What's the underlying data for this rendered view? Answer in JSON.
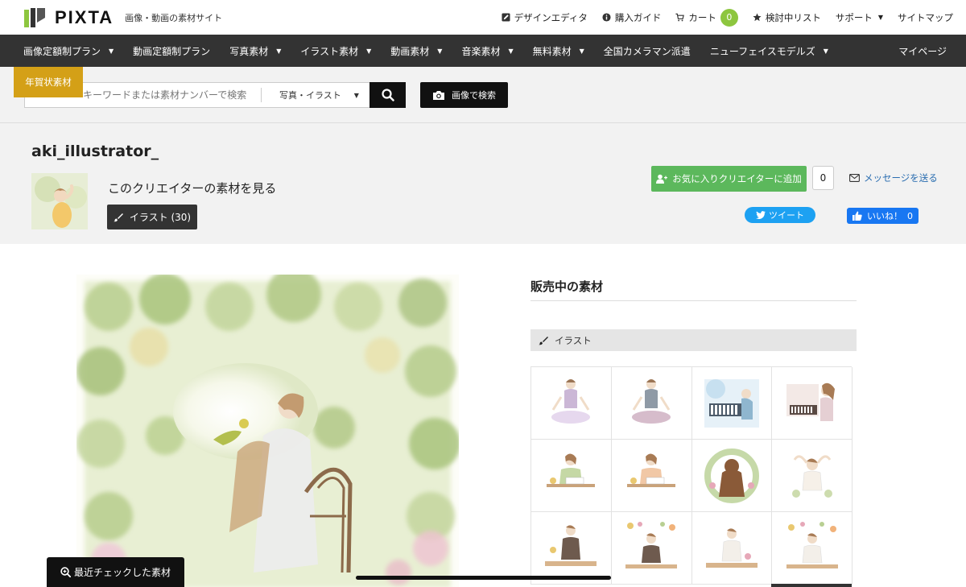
{
  "header": {
    "logo_text": "PIXTA",
    "tagline": "画像・動画の素材サイト",
    "links": [
      {
        "label": "デザインエディタ",
        "icon": "edit-icon"
      },
      {
        "label": "購入ガイド",
        "icon": "info-icon"
      },
      {
        "label": "カート",
        "icon": "cart-icon",
        "badge": "0"
      },
      {
        "label": "検討中リスト",
        "icon": "star-icon"
      },
      {
        "label": "サポート",
        "caret": true
      },
      {
        "label": "サイトマップ"
      }
    ]
  },
  "nav": {
    "items": [
      "画像定額制プラン",
      "動画定額制プラン",
      "写真素材",
      "イラスト素材",
      "動画素材",
      "音楽素材",
      "無料素材",
      "全国カメラマン派遣",
      "ニューフェイスモデルズ"
    ],
    "mypage": "マイページ"
  },
  "search": {
    "nenga_label": "年賀状素材",
    "placeholder": "キーワードまたは素材ナンバーで検索",
    "category": "写真・イラスト",
    "image_search_label": "画像で検索"
  },
  "creator": {
    "name": "aki_illustrator_",
    "see_works": "このクリエイターの素材を見る",
    "illust_count_label": "イラスト (30)",
    "fav_button": "お気に入りクリエイターに追加",
    "fav_count": "0",
    "message_link": "メッセージを送る",
    "tweet_label": "ツイート",
    "like_label": "いいね！",
    "like_count": "0"
  },
  "main": {
    "section_title": "販売中の素材",
    "category_label": "イラスト",
    "thumbnails": [
      {
        "name": "thumb-yoga-woman-1"
      },
      {
        "name": "thumb-yoga-woman-2"
      },
      {
        "name": "thumb-piano-blue"
      },
      {
        "name": "thumb-piano-woman"
      },
      {
        "name": "thumb-desk-woman-1"
      },
      {
        "name": "thumb-desk-woman-2"
      },
      {
        "name": "thumb-flower-wreath"
      },
      {
        "name": "thumb-stretch-woman"
      },
      {
        "name": "thumb-cooking-1"
      },
      {
        "name": "thumb-cooking-2"
      },
      {
        "name": "thumb-cooking-3"
      },
      {
        "name": "thumb-cooking-4"
      }
    ]
  },
  "recent_button": "最近チェックした素材",
  "colors": {
    "nav_bg": "#333333",
    "accent_green": "#5cb85c",
    "cart_badge": "#8dc63f",
    "nenga_gold": "#d4a017",
    "twitter": "#1da1f2",
    "facebook": "#1877f2"
  }
}
